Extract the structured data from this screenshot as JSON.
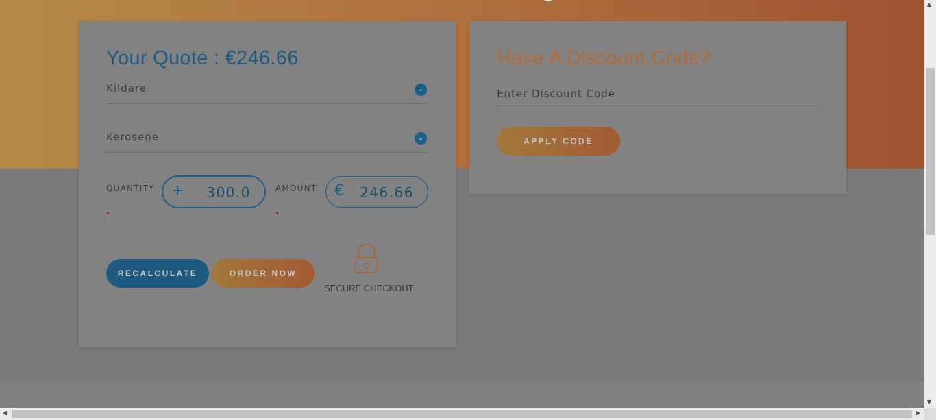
{
  "quote": {
    "title": "Your Quote : €246.66",
    "county": "Kildare",
    "fuel": "Kerosene",
    "quantity_label": "QUANTITY",
    "quantity_value": "300.0",
    "amount_label": "AMOUNT",
    "amount_value": "246.66",
    "currency_symbol": "€",
    "plus_symbol": "+",
    "recalculate_label": "RECALCULATE",
    "order_label": "ORDER NOW",
    "secure_label": "SECURE CHECKOUT"
  },
  "discount": {
    "title": "Have A Discount Code?",
    "placeholder": "Enter Discount Code",
    "apply_label": "APPLY CODE"
  },
  "colors": {
    "brand_blue": "#1a5e8c",
    "brand_orange": "#b36b38"
  },
  "icons": {
    "chevron": "chevron-down-icon",
    "lock": "lock-icon",
    "plus": "plus-icon",
    "euro": "euro-icon"
  }
}
